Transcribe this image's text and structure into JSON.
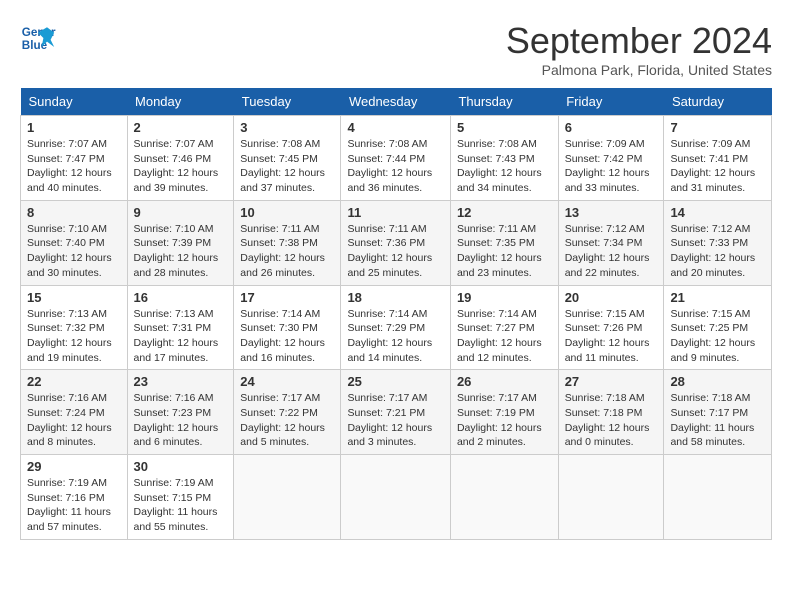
{
  "header": {
    "logo_line1": "General",
    "logo_line2": "Blue",
    "month_title": "September 2024",
    "location": "Palmona Park, Florida, United States"
  },
  "weekdays": [
    "Sunday",
    "Monday",
    "Tuesday",
    "Wednesday",
    "Thursday",
    "Friday",
    "Saturday"
  ],
  "weeks": [
    [
      {
        "day": "1",
        "info": "Sunrise: 7:07 AM\nSunset: 7:47 PM\nDaylight: 12 hours\nand 40 minutes."
      },
      {
        "day": "2",
        "info": "Sunrise: 7:07 AM\nSunset: 7:46 PM\nDaylight: 12 hours\nand 39 minutes."
      },
      {
        "day": "3",
        "info": "Sunrise: 7:08 AM\nSunset: 7:45 PM\nDaylight: 12 hours\nand 37 minutes."
      },
      {
        "day": "4",
        "info": "Sunrise: 7:08 AM\nSunset: 7:44 PM\nDaylight: 12 hours\nand 36 minutes."
      },
      {
        "day": "5",
        "info": "Sunrise: 7:08 AM\nSunset: 7:43 PM\nDaylight: 12 hours\nand 34 minutes."
      },
      {
        "day": "6",
        "info": "Sunrise: 7:09 AM\nSunset: 7:42 PM\nDaylight: 12 hours\nand 33 minutes."
      },
      {
        "day": "7",
        "info": "Sunrise: 7:09 AM\nSunset: 7:41 PM\nDaylight: 12 hours\nand 31 minutes."
      }
    ],
    [
      {
        "day": "8",
        "info": "Sunrise: 7:10 AM\nSunset: 7:40 PM\nDaylight: 12 hours\nand 30 minutes."
      },
      {
        "day": "9",
        "info": "Sunrise: 7:10 AM\nSunset: 7:39 PM\nDaylight: 12 hours\nand 28 minutes."
      },
      {
        "day": "10",
        "info": "Sunrise: 7:11 AM\nSunset: 7:38 PM\nDaylight: 12 hours\nand 26 minutes."
      },
      {
        "day": "11",
        "info": "Sunrise: 7:11 AM\nSunset: 7:36 PM\nDaylight: 12 hours\nand 25 minutes."
      },
      {
        "day": "12",
        "info": "Sunrise: 7:11 AM\nSunset: 7:35 PM\nDaylight: 12 hours\nand 23 minutes."
      },
      {
        "day": "13",
        "info": "Sunrise: 7:12 AM\nSunset: 7:34 PM\nDaylight: 12 hours\nand 22 minutes."
      },
      {
        "day": "14",
        "info": "Sunrise: 7:12 AM\nSunset: 7:33 PM\nDaylight: 12 hours\nand 20 minutes."
      }
    ],
    [
      {
        "day": "15",
        "info": "Sunrise: 7:13 AM\nSunset: 7:32 PM\nDaylight: 12 hours\nand 19 minutes."
      },
      {
        "day": "16",
        "info": "Sunrise: 7:13 AM\nSunset: 7:31 PM\nDaylight: 12 hours\nand 17 minutes."
      },
      {
        "day": "17",
        "info": "Sunrise: 7:14 AM\nSunset: 7:30 PM\nDaylight: 12 hours\nand 16 minutes."
      },
      {
        "day": "18",
        "info": "Sunrise: 7:14 AM\nSunset: 7:29 PM\nDaylight: 12 hours\nand 14 minutes."
      },
      {
        "day": "19",
        "info": "Sunrise: 7:14 AM\nSunset: 7:27 PM\nDaylight: 12 hours\nand 12 minutes."
      },
      {
        "day": "20",
        "info": "Sunrise: 7:15 AM\nSunset: 7:26 PM\nDaylight: 12 hours\nand 11 minutes."
      },
      {
        "day": "21",
        "info": "Sunrise: 7:15 AM\nSunset: 7:25 PM\nDaylight: 12 hours\nand 9 minutes."
      }
    ],
    [
      {
        "day": "22",
        "info": "Sunrise: 7:16 AM\nSunset: 7:24 PM\nDaylight: 12 hours\nand 8 minutes."
      },
      {
        "day": "23",
        "info": "Sunrise: 7:16 AM\nSunset: 7:23 PM\nDaylight: 12 hours\nand 6 minutes."
      },
      {
        "day": "24",
        "info": "Sunrise: 7:17 AM\nSunset: 7:22 PM\nDaylight: 12 hours\nand 5 minutes."
      },
      {
        "day": "25",
        "info": "Sunrise: 7:17 AM\nSunset: 7:21 PM\nDaylight: 12 hours\nand 3 minutes."
      },
      {
        "day": "26",
        "info": "Sunrise: 7:17 AM\nSunset: 7:19 PM\nDaylight: 12 hours\nand 2 minutes."
      },
      {
        "day": "27",
        "info": "Sunrise: 7:18 AM\nSunset: 7:18 PM\nDaylight: 12 hours\nand 0 minutes."
      },
      {
        "day": "28",
        "info": "Sunrise: 7:18 AM\nSunset: 7:17 PM\nDaylight: 11 hours\nand 58 minutes."
      }
    ],
    [
      {
        "day": "29",
        "info": "Sunrise: 7:19 AM\nSunset: 7:16 PM\nDaylight: 11 hours\nand 57 minutes."
      },
      {
        "day": "30",
        "info": "Sunrise: 7:19 AM\nSunset: 7:15 PM\nDaylight: 11 hours\nand 55 minutes."
      },
      {
        "day": "",
        "info": ""
      },
      {
        "day": "",
        "info": ""
      },
      {
        "day": "",
        "info": ""
      },
      {
        "day": "",
        "info": ""
      },
      {
        "day": "",
        "info": ""
      }
    ]
  ]
}
